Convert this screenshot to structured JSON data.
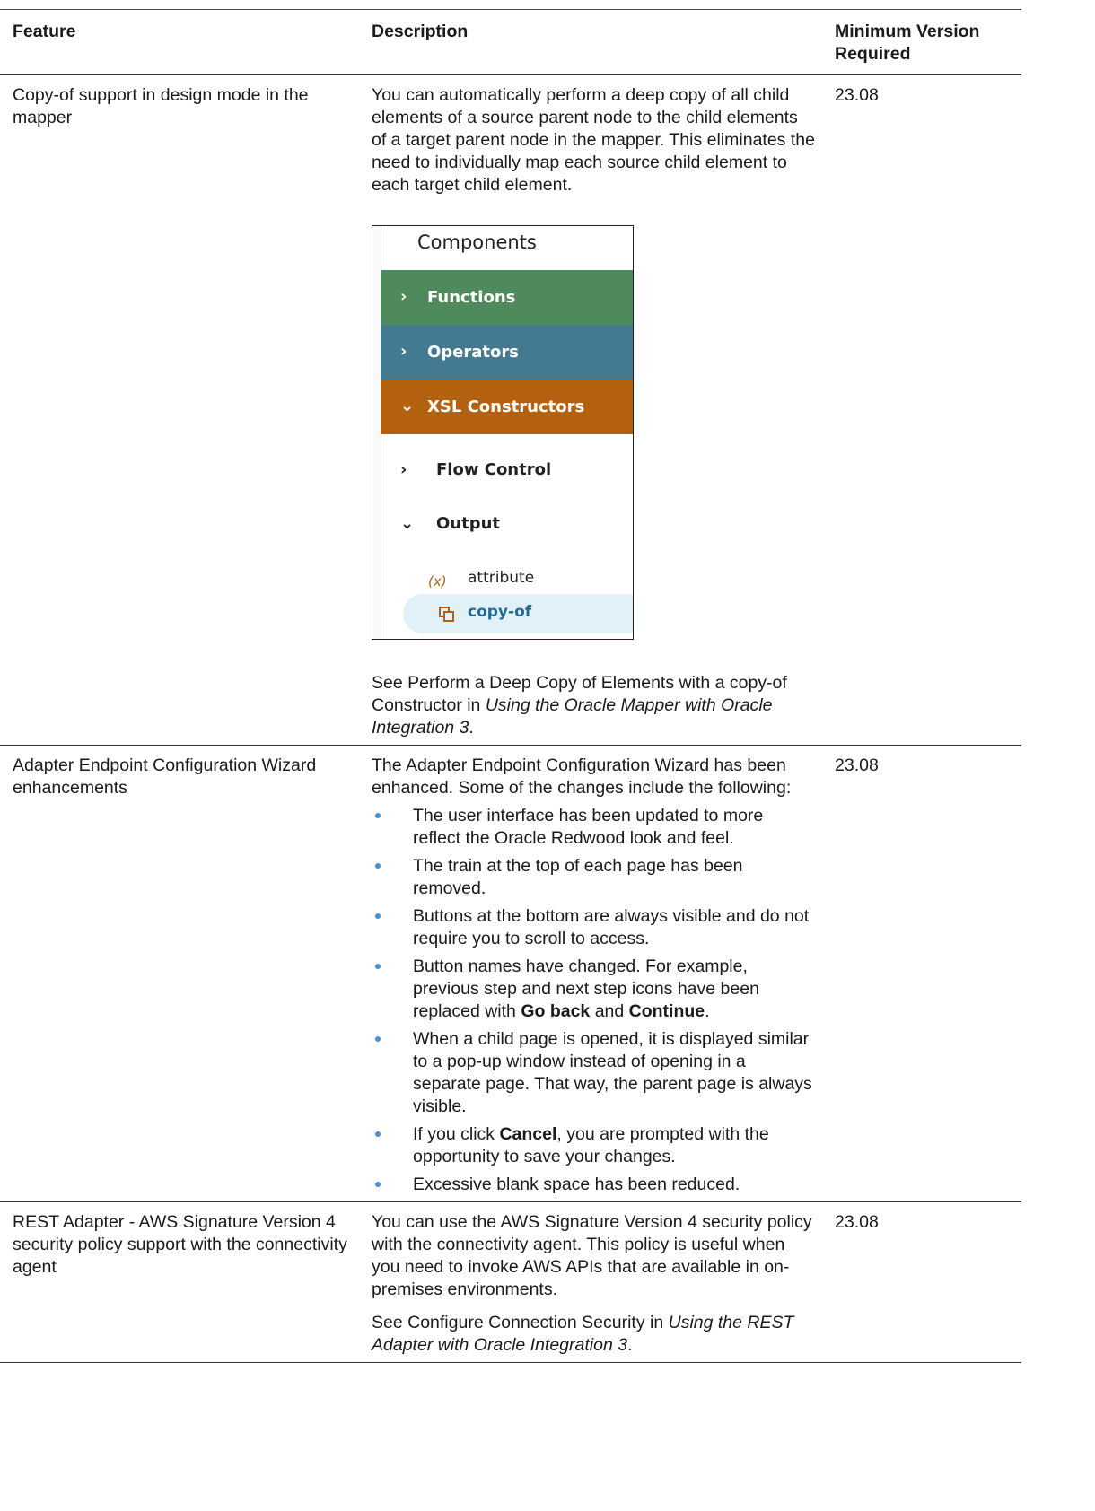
{
  "headers": {
    "feature": "Feature",
    "description": "Description",
    "version": "Minimum Version Required"
  },
  "rows": [
    {
      "feature": "Copy-of support in design mode in the mapper",
      "desc_p1": "You can automatically perform a deep copy of all child elements of a source parent node to the child elements of a target parent node in the mapper. This eliminates the need to individually map each source child element to each target child element.",
      "see_prefix": "See Perform a Deep Copy of Elements with a copy-of Constructor in ",
      "see_book": "Using the Oracle Mapper with Oracle Integration 3",
      "see_suffix": ".",
      "version": "23.08"
    },
    {
      "feature": "Adapter Endpoint Configuration Wizard enhancements",
      "intro": "The Adapter Endpoint Configuration Wizard has been enhanced. Some of the changes include the following:",
      "b1": "The user interface has been updated to more reflect the Oracle Redwood look and feel.",
      "b2": "The train at the top of each page has been removed.",
      "b3": "Buttons at the bottom are always visible and do not require you to scroll to access.",
      "b4_pre": "Button names have changed. For example, previous step and next step icons have been replaced with ",
      "b4_bold1": "Go back",
      "b4_mid": " and ",
      "b4_bold2": "Continue",
      "b4_end": ".",
      "b5": "When a child page is opened, it is displayed similar to a pop-up window instead of opening in a separate page. That way, the parent page is always visible.",
      "b6_pre": "If you click ",
      "b6_bold": "Cancel",
      "b6_post": ", you are prompted with the opportunity to save your changes.",
      "b7": "Excessive blank space has been reduced.",
      "version": "23.08"
    },
    {
      "feature": "REST Adapter - AWS Signature Version 4 security policy support with the connectivity agent",
      "desc_p1": "You can use the AWS Signature Version 4 security policy with the connectivity agent. This policy is useful when you need to invoke AWS APIs that are available in on-premises environments.",
      "see_prefix": "See Configure Connection Security in ",
      "see_book": "Using the REST Adapter with Oracle Integration 3",
      "see_suffix": ".",
      "version": "23.08"
    }
  ],
  "components_panel": {
    "title": "Components",
    "functions": "Functions",
    "operators": "Operators",
    "xsl_constructors": "XSL Constructors",
    "flow_control": "Flow Control",
    "output": "Output",
    "attribute": "attribute",
    "attribute_icon_text": "(x)",
    "copy_of": "copy-of",
    "colors": {
      "functions": "#4e8a5c",
      "operators": "#437a92",
      "xsl_constructors": "#b3610f",
      "selected_bg": "#e2f0f7",
      "selected_text": "#226b96"
    }
  }
}
